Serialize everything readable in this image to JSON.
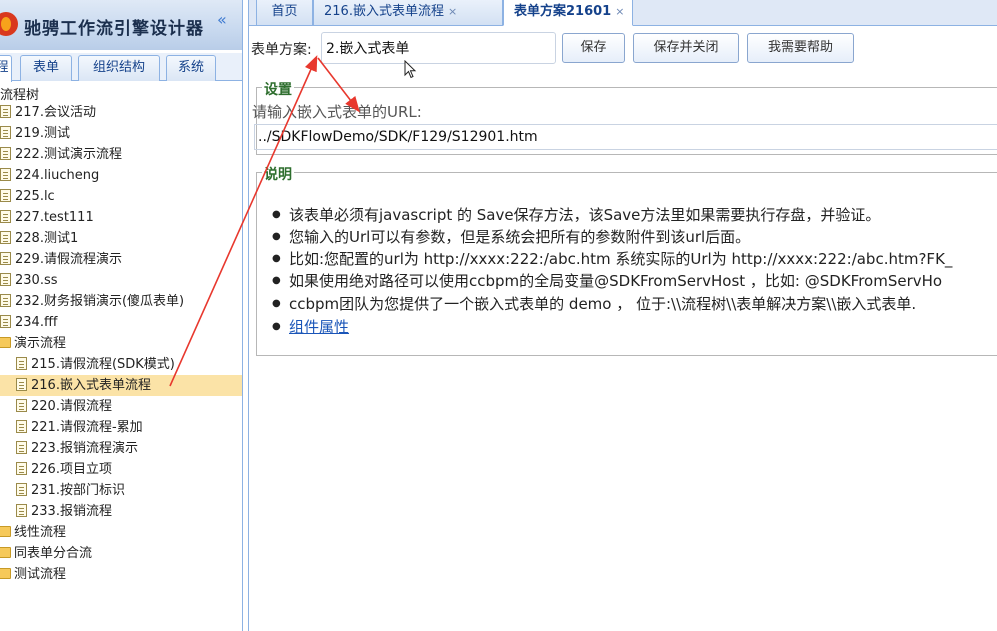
{
  "app": {
    "title": "驰骋工作流引擎设计器",
    "collapse_glyph": "«"
  },
  "left_tabs": [
    {
      "label": "程"
    },
    {
      "label": "表单"
    },
    {
      "label": "组织结构"
    },
    {
      "label": "系统"
    }
  ],
  "tree": {
    "root_label": "流程树",
    "items": [
      {
        "label": "217.会议活动",
        "icon": "document-icon"
      },
      {
        "label": "219.测试",
        "icon": "document-icon"
      },
      {
        "label": "222.测试演示流程",
        "icon": "document-icon"
      },
      {
        "label": "224.liucheng",
        "icon": "document-icon"
      },
      {
        "label": "225.lc",
        "icon": "document-icon"
      },
      {
        "label": "227.test111",
        "icon": "document-icon"
      },
      {
        "label": "228.测试1",
        "icon": "document-icon"
      },
      {
        "label": "229.请假流程演示",
        "icon": "document-icon"
      },
      {
        "label": "230.ss",
        "icon": "document-icon"
      },
      {
        "label": "232.财务报销演示(傻瓜表单)",
        "icon": "document-icon"
      },
      {
        "label": "234.fff",
        "icon": "document-icon"
      },
      {
        "label": "演示流程",
        "icon": "folder-icon"
      },
      {
        "label": "215.请假流程(SDK模式)",
        "icon": "document-icon"
      },
      {
        "label": "216.嵌入式表单流程",
        "icon": "document-icon",
        "selected": true
      },
      {
        "label": "220.请假流程",
        "icon": "document-icon"
      },
      {
        "label": "221.请假流程-累加",
        "icon": "document-icon"
      },
      {
        "label": "223.报销流程演示",
        "icon": "document-icon"
      },
      {
        "label": "226.项目立项",
        "icon": "document-icon"
      },
      {
        "label": "231.按部门标识",
        "icon": "document-icon"
      },
      {
        "label": "233.报销流程",
        "icon": "document-icon"
      },
      {
        "label": "线性流程",
        "icon": "folder-icon"
      },
      {
        "label": "同表单分合流",
        "icon": "folder-icon"
      },
      {
        "label": "测试流程",
        "icon": "folder-icon"
      }
    ]
  },
  "tabs": [
    {
      "label": "首页",
      "closable": false
    },
    {
      "label": "216.嵌入式表单流程",
      "closable": true
    },
    {
      "label": "表单方案21601",
      "closable": true,
      "active": true
    }
  ],
  "tab_close_glyph": "×",
  "form": {
    "label": "表单方案:",
    "value": "2.嵌入式表单",
    "buttons": {
      "save": "保存",
      "save_close": "保存并关闭",
      "help": "我需要帮助"
    }
  },
  "settings": {
    "legend": "设置",
    "url_label": "请输入嵌入式表单的URL:",
    "url_value": "../SDKFlowDemo/SDK/F129/S12901.htm"
  },
  "notes": {
    "legend": "说明",
    "items": [
      "该表单必须有javascript 的 Save保存方法，该Save方法里如果需要执行存盘，并验证。",
      "您输入的Url可以有参数，但是系统会把所有的参数附件到该url后面。",
      "比如:您配置的url为 http://xxxx:222:/abc.htm 系统实际的Url为 http://xxxx:222:/abc.htm?FK_",
      "如果使用绝对路径可以使用ccbpm的全局变量@SDKFromServHost ，比如: @SDKFromServHo",
      "ccbpm团队为您提供了一个嵌入式表单的 demo ， 位于:\\\\流程树\\\\表单解决方案\\\\嵌入式表单."
    ],
    "link": "组件属性"
  },
  "colors": {
    "accent": "#15428b",
    "annotation": "#e8382e",
    "selected_row": "#fbe3a7",
    "legend": "#2e6e2e"
  }
}
